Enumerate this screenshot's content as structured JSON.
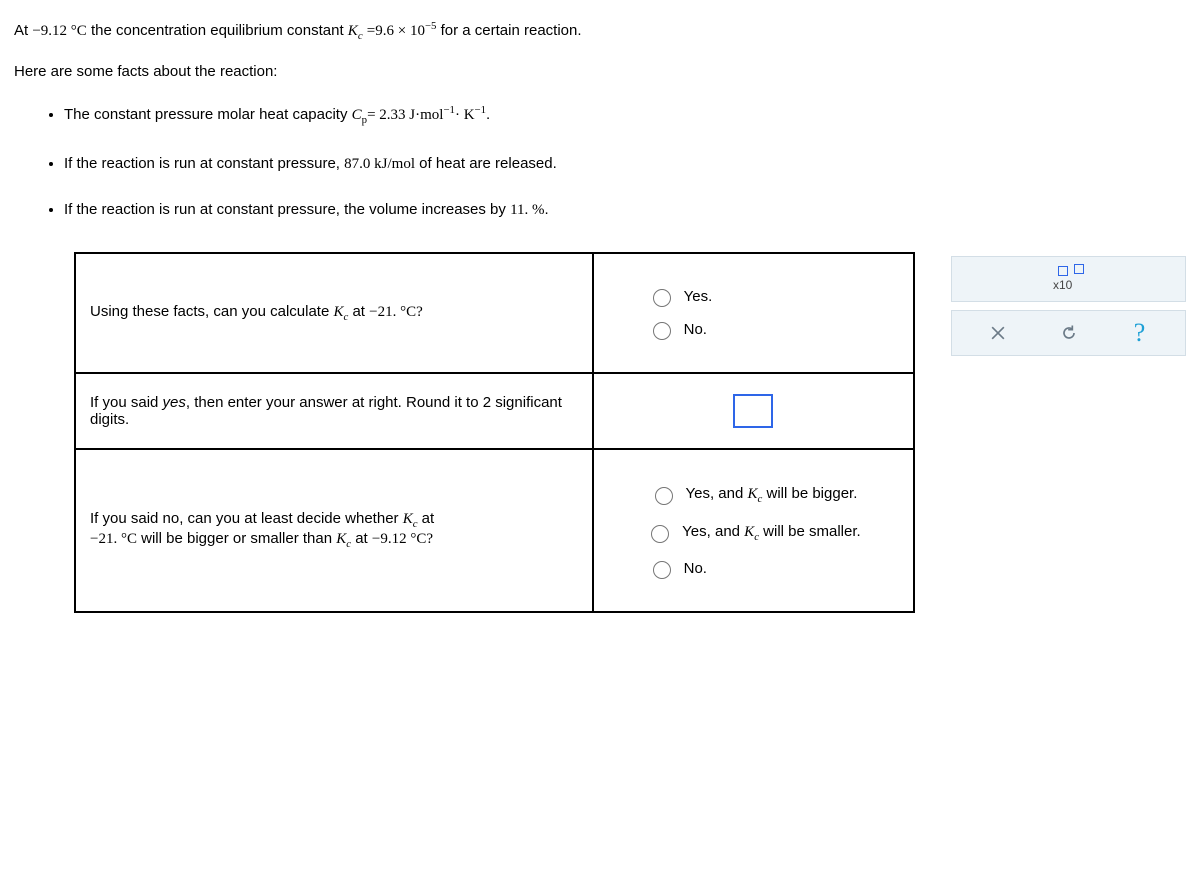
{
  "intro": {
    "p1_a": "At ",
    "t1": "−9.12 °C",
    "p1_b": " the concentration equilibrium constant ",
    "p1_c": " for a certain reaction.",
    "kc_expr": "=9.6 × 10",
    "kc_sup": "−5",
    "facts_heading": "Here are some facts about the reaction:",
    "f1_a": "The constant pressure molar heat capacity ",
    "cp_val": "= 2.33 J·mol",
    "cp_sup1": "−1",
    "cp_mid": "· K",
    "cp_sup2": "−1",
    "cp_end": ".",
    "f2_a": "If the reaction is run at constant pressure, ",
    "f2_b": "87.0  kJ/mol",
    "f2_c": " of heat are released.",
    "f3_a": "If the reaction is run at constant pressure, the volume increases by ",
    "f3_b": "11. %",
    "f3_c": "."
  },
  "q1": {
    "prompt_a": "Using these facts, can you calculate ",
    "prompt_b": " at ",
    "prompt_c": "−21. °C?",
    "yes": "Yes.",
    "no": "No."
  },
  "q2": {
    "prompt_pre": "If you said ",
    "prompt_yes": "yes",
    "prompt_post": ", then enter your answer at right. Round it to 2 significant digits."
  },
  "q3": {
    "prompt_a": "If you said no, can you at least decide whether ",
    "prompt_b": " at ",
    "t2": "−21. °C",
    "prompt_c": " will be bigger or smaller than ",
    "prompt_d": " at ",
    "t1": "−9.12 °C?",
    "opt1_a": "Yes, and ",
    "opt1_b": " will be bigger.",
    "opt2_a": "Yes, and ",
    "opt2_b": " will be smaller.",
    "no": "No."
  },
  "tools": {
    "x10": "x10"
  },
  "sym": {
    "K": "K",
    "c": "c",
    "Cp_C": "C",
    "Cp_p": "p"
  }
}
